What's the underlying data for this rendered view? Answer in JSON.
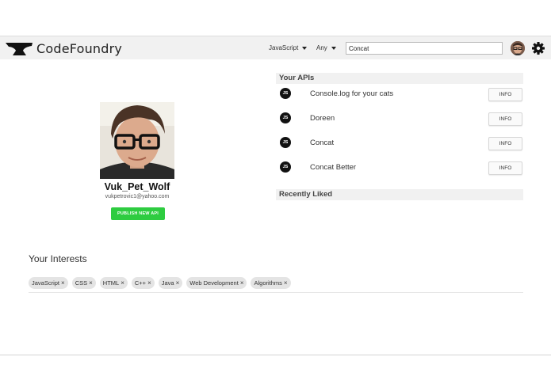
{
  "app": {
    "brand": "CodeFoundry"
  },
  "header": {
    "language_select": "JavaScript",
    "filter_select": "Any",
    "search": {
      "value": "Concat"
    }
  },
  "profile": {
    "username": "Vuk_Pet_Wolf",
    "email": "vukpetrovic1@yahoo.com",
    "publish_label": "PUBLISH NEW API"
  },
  "apis": {
    "title": "Your APIs",
    "items": [
      {
        "badge": "JS",
        "name": "Console.log for your cats",
        "action": "INFO"
      },
      {
        "badge": "JS",
        "name": "Doreen",
        "action": "INFO"
      },
      {
        "badge": "JS",
        "name": "Concat",
        "action": "INFO"
      },
      {
        "badge": "JS",
        "name": "Concat Better",
        "action": "INFO"
      }
    ]
  },
  "recently_liked": {
    "title": "Recently Liked"
  },
  "interests": {
    "title": "Your Interests",
    "remove_glyph": "×",
    "tags": [
      "JavaScript",
      "CSS",
      "HTML",
      "C++",
      "Java",
      "Web Development",
      "Algorithms"
    ]
  },
  "colors": {
    "accent_green": "#2ecc40",
    "header_bg": "#f1f1f1",
    "badge_bg": "#111111"
  },
  "icons": [
    "anvil-logo-icon",
    "caret-down-icon",
    "user-avatar",
    "gear-icon",
    "js-badge-icon",
    "remove-tag-icon"
  ]
}
